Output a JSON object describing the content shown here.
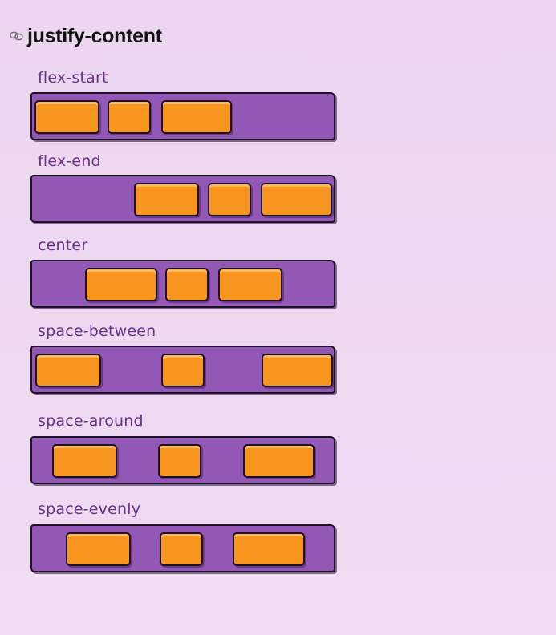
{
  "header": {
    "title": "justify-content",
    "icon": "link-icon"
  },
  "colors": {
    "background": "#ecd6f0",
    "container": "#9357b6",
    "item": "#f7951f",
    "label": "#6b2e8c",
    "outline": "#1e1226"
  },
  "sections": [
    {
      "label": "flex-start"
    },
    {
      "label": "flex-end"
    },
    {
      "label": "center"
    },
    {
      "label": "space-between"
    },
    {
      "label": "space-around"
    },
    {
      "label": "space-evenly"
    }
  ]
}
